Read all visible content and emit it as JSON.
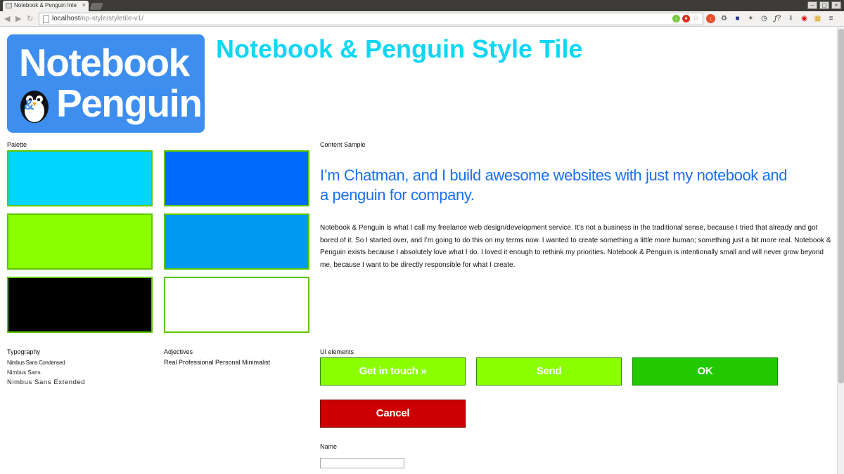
{
  "browser": {
    "tab_title": "Notebook & Penguin Inte",
    "tab_close": "×",
    "url_host": "localhost",
    "url_path": "/np-style/styletile-v1/",
    "window_buttons": [
      "–",
      "◻",
      "×"
    ]
  },
  "logo": {
    "line1": "Notebook",
    "line2": "Penguin",
    "ampersand": "&"
  },
  "page": {
    "title": "Notebook & Penguin Style Tile",
    "palette_label": "Palette",
    "content_sample_label": "Content Sample",
    "intro": "I’m Chatman, and I build awesome websites with just my notebook and a penguin for company.",
    "body": "Notebook & Penguin is what I call my freelance web design/development service. It’s not a business in the traditional sense, because I tried that already and got bored of it. So I started over, and I’m going to do this on my terms now. I wanted to create something a little more human; something just a bit more real. Notebook & Penguin exists because I absolutely love what I do. I loved it enough to rethink my priorities. Notebook & Penguin is intentionally small and will never grow beyond me, because I want to be directly responsible for what I create."
  },
  "palette": {
    "colors": [
      "#00d5ff",
      "#0068fa",
      "#8aff00",
      "#0099f2",
      "#000000",
      "#ffffff"
    ],
    "border_color": "#5ec600"
  },
  "typography": {
    "label": "Typography",
    "fonts": [
      "Nimbus Sans Condensed",
      "Nimbus Sans",
      "Nimbus Sans Extended"
    ]
  },
  "adjectives": {
    "label": "Adjectives",
    "values": "Real Professional Personal Minimalist"
  },
  "ui_elements": {
    "label": "UI elements",
    "buttons": [
      {
        "label": "Get in touch »",
        "color": "#8aff00"
      },
      {
        "label": "Send",
        "color": "#8aff00"
      },
      {
        "label": "OK",
        "color": "#22c800"
      },
      {
        "label": "Cancel",
        "color": "#cc0000"
      }
    ],
    "name_label": "Name",
    "name_value": ""
  }
}
